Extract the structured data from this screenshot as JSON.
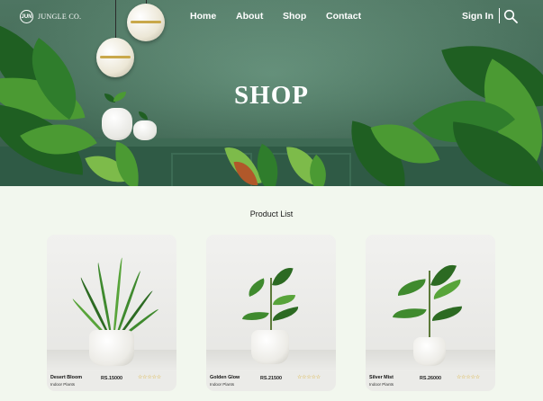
{
  "brand": {
    "mark": "JUN",
    "name": "JUNGLE CO."
  },
  "nav": {
    "links": [
      "Home",
      "About",
      "Shop",
      "Contact"
    ],
    "signin": "Sign In"
  },
  "hero": {
    "title": "SHOP"
  },
  "products": {
    "heading": "Product List",
    "items": [
      {
        "name": "Desert Bloom",
        "category": "Indoor Plants",
        "price": "RS.15000",
        "stars": "☆☆☆☆☆"
      },
      {
        "name": "Golden Glow",
        "category": "Indoor Plants",
        "price": "RS.21500",
        "stars": "☆☆☆☆☆"
      },
      {
        "name": "Silver Mist",
        "category": "Indoor Plants",
        "price": "RS.26000",
        "stars": "☆☆☆☆☆"
      }
    ]
  },
  "icons": {
    "search": "search-icon",
    "logo": "leaf-logo-icon"
  },
  "colors": {
    "background": "#f2f7ee",
    "hero_wall": "#5f8f77",
    "star": "#d8a81c"
  }
}
